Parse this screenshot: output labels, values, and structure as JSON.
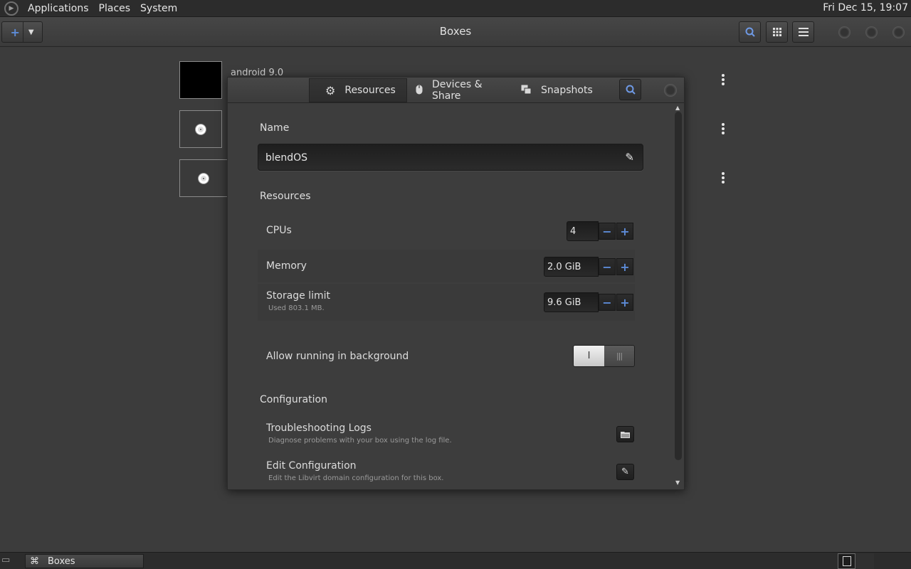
{
  "top_panel": {
    "menus": [
      "Applications",
      "Places",
      "System"
    ],
    "clock": "Fri Dec 15, 19:07"
  },
  "headerbar": {
    "title": "Boxes",
    "new_icon": "plus-icon",
    "dropdown_icon": "chevron-down-icon",
    "search_icon": "search-icon",
    "grid_icon": "grid-icon",
    "menu_icon": "hamburger-icon"
  },
  "boxes": [
    {
      "name": "android 9.0"
    },
    {
      "name": ""
    },
    {
      "name": ""
    }
  ],
  "dialog": {
    "tabs": {
      "resources": "Resources",
      "devices": "Devices & Share",
      "snapshots": "Snapshots"
    },
    "name_section": {
      "label": "Name",
      "value": "blendOS"
    },
    "resources_section": {
      "label": "Resources",
      "cpus_label": "CPUs",
      "cpus_value": "4",
      "memory_label": "Memory",
      "memory_value": "2.0 GiB",
      "storage_label": "Storage limit",
      "storage_sub": "Used 803.1 MB.",
      "storage_value": "9.6 GiB",
      "background_label": "Allow running in background",
      "background_on_text": "I",
      "background_off_text": "|||",
      "background_enabled": true
    },
    "configuration_section": {
      "label": "Configuration",
      "logs_label": "Troubleshooting Logs",
      "logs_sub": "Diagnose problems with your box using the log file.",
      "edit_label": "Edit Configuration",
      "edit_sub": "Edit the Libvirt domain configuration for this box."
    }
  },
  "taskbar": {
    "task_label": "Boxes"
  },
  "colors": {
    "accent": "#5d8cd8",
    "background": "#3c3c3c",
    "panel": "#2c2c2c"
  }
}
